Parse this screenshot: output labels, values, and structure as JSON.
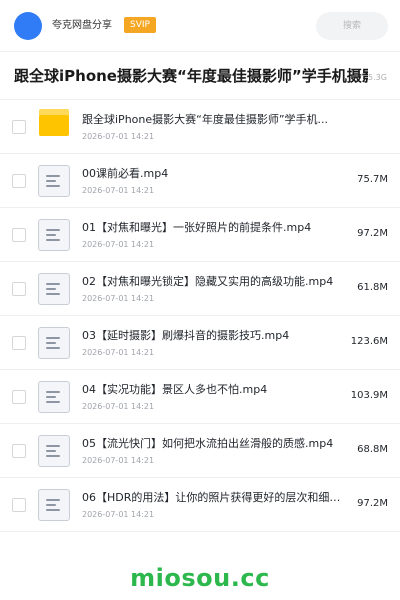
{
  "header": {
    "username": "夸克网盘分享",
    "badge": "SVIP",
    "search_placeholder": "搜索",
    "accent_color": "#2f7cf6",
    "badge_color": "#f5a623"
  },
  "share": {
    "title": "跟全球iPhone摄影大赛“年度最佳摄影师”学手机摄影",
    "total_size": "5.3G"
  },
  "files": [
    {
      "icon": "folder-icon",
      "name": "跟全球iPhone摄影大赛“年度最佳摄影师”学手机...",
      "date": "2026-07-01 14:21",
      "size": ""
    },
    {
      "icon": "file-icon",
      "name": "00课前必看.mp4",
      "date": "2026-07-01 14:21",
      "size": "75.7M"
    },
    {
      "icon": "file-icon",
      "name": "01【对焦和曝光】一张好照片的前提条件.mp4",
      "date": "2026-07-01 14:21",
      "size": "97.2M"
    },
    {
      "icon": "file-icon",
      "name": "02【对焦和曝光锁定】隐藏又实用的高级功能.mp4",
      "date": "2026-07-01 14:21",
      "size": "61.8M"
    },
    {
      "icon": "file-icon",
      "name": "03【延时摄影】刷爆抖音的摄影技巧.mp4",
      "date": "2026-07-01 14:21",
      "size": "123.6M"
    },
    {
      "icon": "file-icon",
      "name": "04【实况功能】景区人多也不怕.mp4",
      "date": "2026-07-01 14:21",
      "size": "103.9M"
    },
    {
      "icon": "file-icon",
      "name": "05【流光快门】如何把水流拍出丝滑般的质感.mp4",
      "date": "2026-07-01 14:21",
      "size": "68.8M"
    },
    {
      "icon": "file-icon",
      "name": "06【HDR的用法】让你的照片获得更好的层次和细节...",
      "date": "2026-07-01 14:21",
      "size": "97.2M"
    }
  ],
  "watermark": "miosou.cc"
}
